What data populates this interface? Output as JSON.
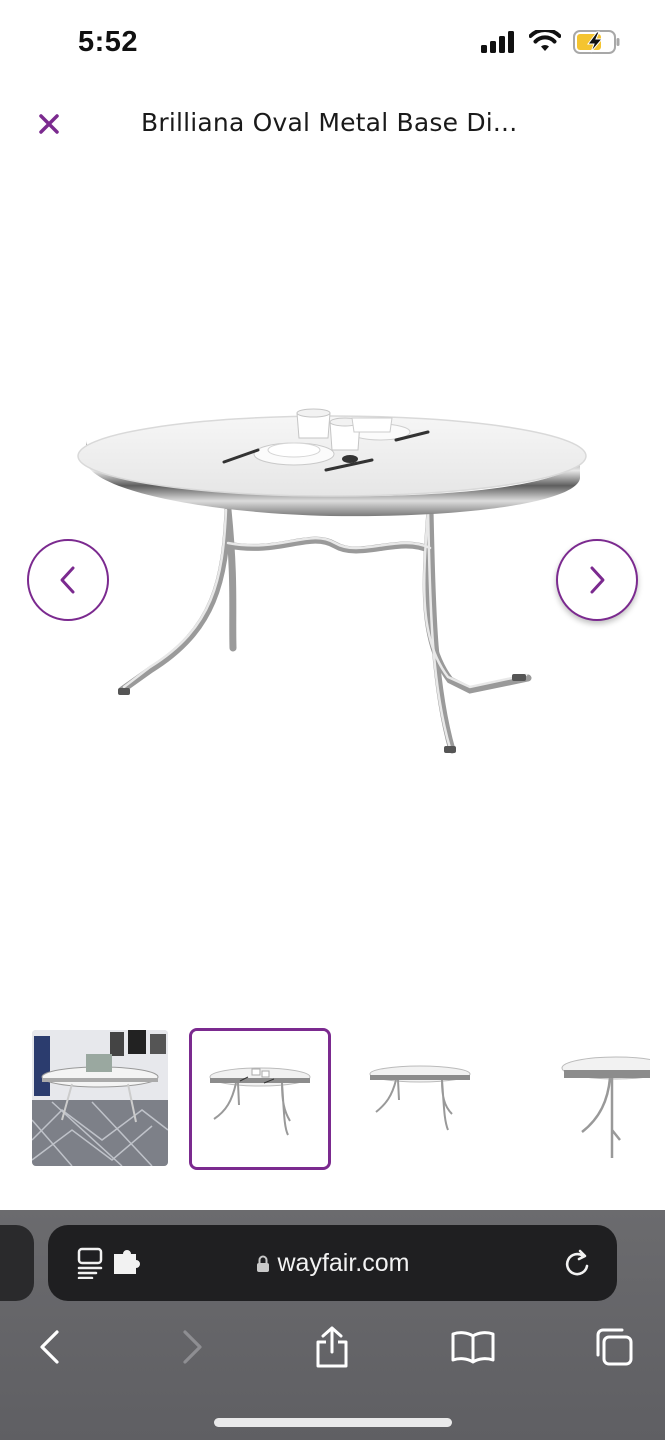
{
  "status_bar": {
    "time": "5:52",
    "icons": [
      "cellular-signal-icon",
      "wifi-icon",
      "battery-charging-icon"
    ]
  },
  "header": {
    "title": "Brilliana Oval Metal Base Di...",
    "close_icon": "close-icon"
  },
  "gallery": {
    "main_image": "oval-chrome-dining-table-image",
    "prev_icon": "chevron-left-icon",
    "next_icon": "chevron-right-icon",
    "thumbnails": [
      "room-scene-thumbnail",
      "table-with-tableware-thumbnail",
      "table-plain-thumbnail",
      "table-angle-thumbnail"
    ],
    "selected_thumbnail": 2
  },
  "safari": {
    "url": "wayfair.com",
    "lock_icon": "lock-icon",
    "page_menu_icon": "page-menu-icon",
    "extension_icon": "extension-icon",
    "reload_icon": "reload-icon",
    "toolbar": [
      "back-icon",
      "forward-icon",
      "share-icon",
      "bookmarks-icon",
      "tabs-icon"
    ]
  },
  "colors": {
    "accent": "#7b2a8f",
    "safari_bar": "#5f5f63",
    "address_bar": "#1f1f21"
  }
}
